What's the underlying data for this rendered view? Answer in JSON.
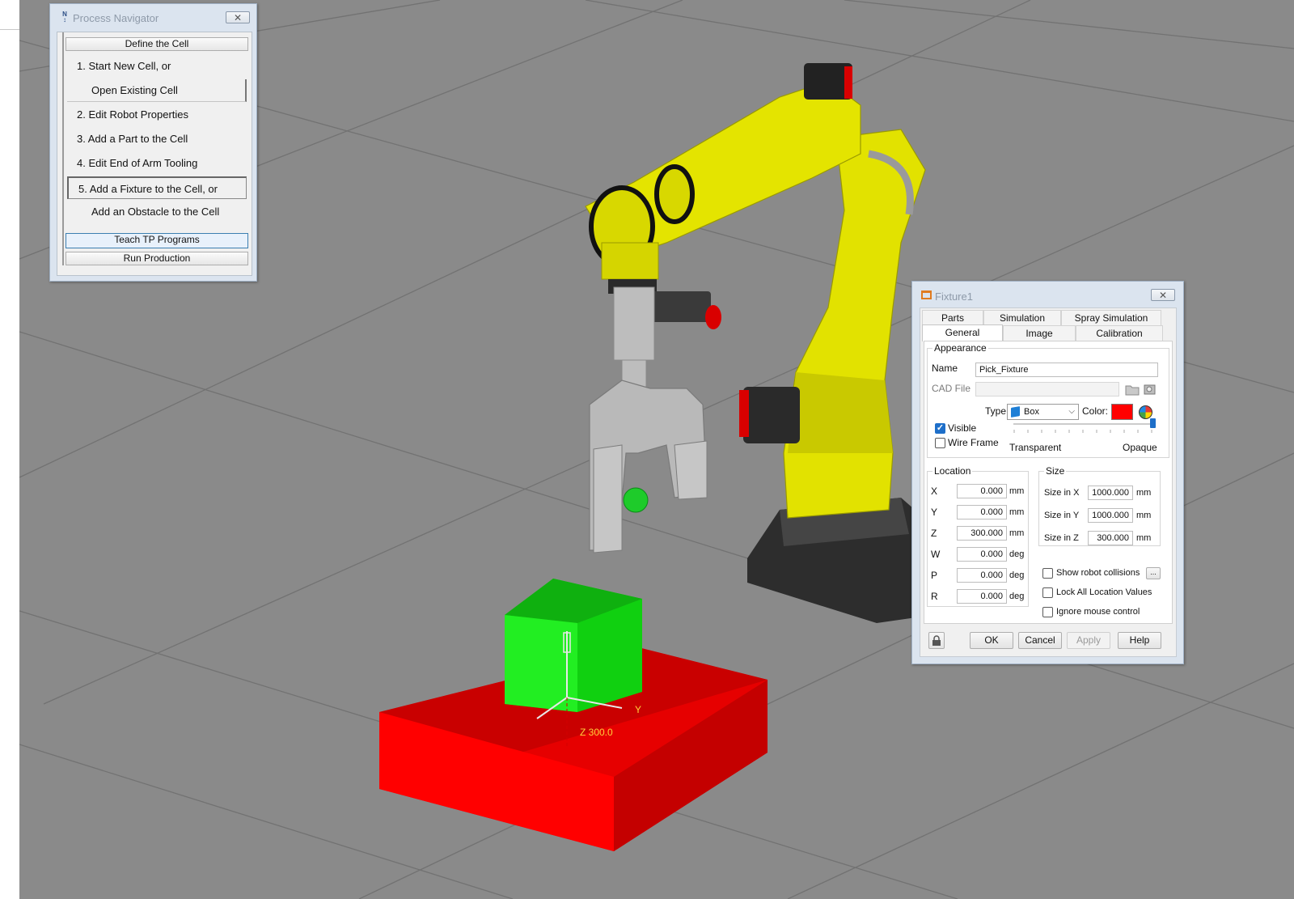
{
  "process_navigator": {
    "title": "Process Navigator",
    "close": "✕",
    "define_label": "Define the Cell",
    "steps": [
      {
        "label": "1.  Start New Cell, or"
      },
      {
        "label": "Open Existing Cell"
      },
      {
        "label": "2.  Edit Robot Properties"
      },
      {
        "label": "3.  Add a Part to the Cell"
      },
      {
        "label": "4.  Edit End of Arm Tooling"
      },
      {
        "label": "5.  Add a Fixture to the Cell, or"
      },
      {
        "label": "Add an Obstacle to the Cell"
      }
    ],
    "teach_label": "Teach TP Programs",
    "run_label": "Run Production"
  },
  "fixture_dialog": {
    "title": "Fixture1",
    "close": "✕",
    "tabs_back": [
      "Parts",
      "Simulation",
      "Spray Simulation"
    ],
    "tabs_front": [
      "General",
      "Image",
      "Calibration"
    ],
    "appearance": {
      "caption": "Appearance",
      "name_label": "Name",
      "name_value": "Pick_Fixture",
      "cad_label": "CAD File",
      "cad_value": "",
      "type_label": "Type",
      "type_value": "Box",
      "color_label": "Color:",
      "color_value": "#ff0000",
      "visible_label": "Visible",
      "visible_checked": true,
      "wireframe_label": "Wire Frame",
      "wireframe_checked": false,
      "transparent_label": "Transparent",
      "opaque_label": "Opaque",
      "opacity": 1.0
    },
    "location": {
      "caption": "Location",
      "rows": [
        {
          "label": "X",
          "value": "0.000",
          "unit": "mm"
        },
        {
          "label": "Y",
          "value": "0.000",
          "unit": "mm"
        },
        {
          "label": "Z",
          "value": "300.000",
          "unit": "mm"
        },
        {
          "label": "W",
          "value": "0.000",
          "unit": "deg"
        },
        {
          "label": "P",
          "value": "0.000",
          "unit": "deg"
        },
        {
          "label": "R",
          "value": "0.000",
          "unit": "deg"
        }
      ]
    },
    "size": {
      "caption": "Size",
      "rows": [
        {
          "label": "Size in X",
          "value": "1000.000",
          "unit": "mm"
        },
        {
          "label": "Size in Y",
          "value": "1000.000",
          "unit": "mm"
        },
        {
          "label": "Size in Z",
          "value": "300.000",
          "unit": "mm"
        }
      ]
    },
    "options": {
      "show_collisions": "Show robot collisions",
      "more": "...",
      "lock_values": "Lock All Location Values",
      "ignore_mouse": "Ignore mouse control"
    },
    "buttons": {
      "ok": "OK",
      "cancel": "Cancel",
      "apply": "Apply",
      "help": "Help"
    }
  },
  "scene": {
    "z_label": "Z 300.0",
    "axis_y": "Y",
    "fixture_color": "#ff0000",
    "part_color": "#00e000",
    "robot_color": "#e6e600"
  }
}
